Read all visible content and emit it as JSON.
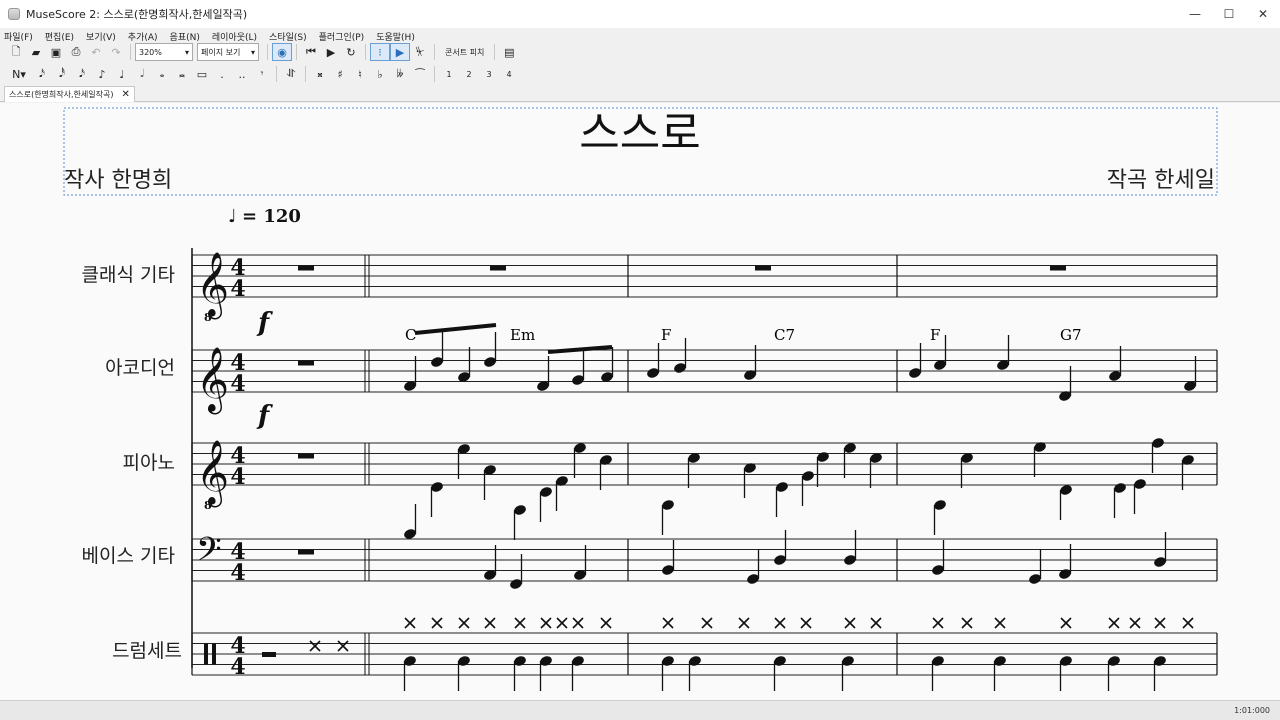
{
  "window": {
    "title": "MuseScore 2: 스스로(한명희작사,한세일작곡)"
  },
  "menu": [
    "파일(F)",
    "편집(E)",
    "보기(V)",
    "추가(A)",
    "음표(N)",
    "레이아웃(L)",
    "스타일(S)",
    "플러그인(P)",
    "도움말(H)"
  ],
  "toolbar": {
    "zoom": "320%",
    "view_mode": "페이지 보기",
    "concert_pitch": "콘서트 피치"
  },
  "voices": [
    "1",
    "2",
    "3",
    "4"
  ],
  "tab": {
    "label": "스스로(한명희작사,한세일작곡)"
  },
  "score": {
    "title": "스스로",
    "lyricist": "작사 한명희",
    "composer": "작곡 한세일",
    "tempo": "= 120",
    "instruments": [
      "클래식 기타",
      "아코디언",
      "피아노",
      "베이스 기타",
      "드럼세트"
    ],
    "time_signature": {
      "num": "4",
      "den": "4"
    },
    "dynamics": [
      "f",
      "f"
    ],
    "chords": [
      "C",
      "Em",
      "F",
      "C7",
      "F",
      "G7"
    ]
  },
  "status": {
    "position": "1:01:000"
  }
}
